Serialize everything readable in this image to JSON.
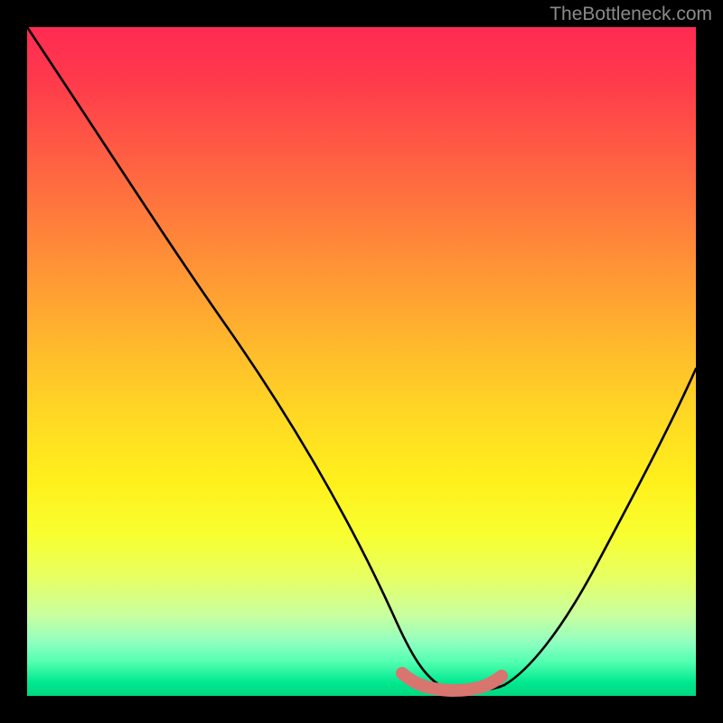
{
  "watermark": "TheBottleneck.com",
  "chart_data": {
    "type": "line",
    "title": "",
    "xlabel": "",
    "ylabel": "",
    "xlim": [
      0,
      100
    ],
    "ylim": [
      0,
      100
    ],
    "grid": false,
    "series": [
      {
        "name": "bottleneck-curve",
        "x": [
          0,
          10,
          20,
          30,
          40,
          50,
          58,
          62,
          68,
          72,
          80,
          90,
          100
        ],
        "values": [
          100,
          86,
          71,
          56,
          40,
          23,
          6,
          1,
          1,
          3,
          14,
          31,
          49
        ],
        "color": "#000000"
      },
      {
        "name": "optimal-band",
        "x": [
          57,
          60,
          64,
          68,
          71
        ],
        "values": [
          3,
          1,
          1,
          1,
          2
        ],
        "color": "#d9756f"
      }
    ],
    "background_gradient": {
      "top": "#ff2b52",
      "middle": "#ffe020",
      "bottom": "#00d880"
    }
  }
}
